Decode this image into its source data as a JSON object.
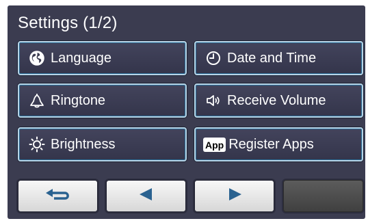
{
  "header": {
    "title": "Settings (1/2)"
  },
  "menu": {
    "language": "Language",
    "date_time": "Date and Time",
    "ringtone": "Ringtone",
    "receive_volume": "Receive Volume",
    "brightness": "Brightness",
    "register_apps": "Register Apps",
    "app_badge": "App"
  },
  "nav": {
    "back_icon": "return-arrow-icon",
    "prev_icon": "triangle-left-icon",
    "next_icon": "triangle-right-icon",
    "fourth_state": "disabled"
  },
  "colors": {
    "background": "#3b3c50",
    "button_border": "#b7d4e6",
    "nav_icon": "#2a6290"
  }
}
